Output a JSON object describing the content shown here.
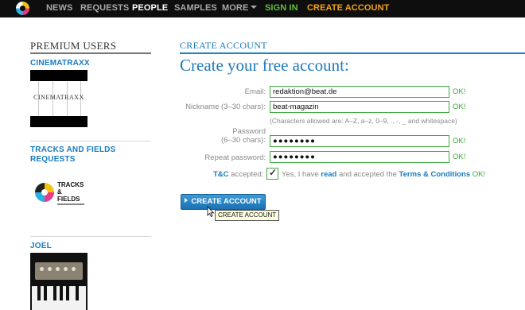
{
  "nav": {
    "items": [
      {
        "label": "NEWS"
      },
      {
        "label": "REQUESTS"
      },
      {
        "label": "PEOPLE"
      },
      {
        "label": "SAMPLES"
      },
      {
        "label": "MORE"
      },
      {
        "label": "SIGN IN"
      },
      {
        "label": "CREATE ACCOUNT"
      }
    ],
    "active": "PEOPLE",
    "logo_icon": "site-logo-icon"
  },
  "sidebar": {
    "title": "PREMIUM USERS",
    "users": [
      {
        "name": "CINEMATRAXX",
        "image_text": "CINEMATRAXX"
      },
      {
        "name": "TRACKS AND FIELDS REQUESTS",
        "name_line1": "TRACKS AND FIELDS",
        "name_line2": "REQUESTS",
        "logo_line1": "TRACKS",
        "logo_line2": "&",
        "logo_line3": "FIELDS"
      },
      {
        "name": "JOEL"
      }
    ]
  },
  "form": {
    "section_title": "CREATE ACCOUNT",
    "heading": "Create your free account:",
    "email_label": "Email:",
    "email_value": "redaktion@beat.de",
    "nickname_label": "Nickname (3–30 chars):",
    "nickname_value": "beat-magazin",
    "nickname_hint": "(Characters allowed are: A–Z, a–z, 0–9, ., -, _ and whitespace)",
    "password_label_line1": "Password",
    "password_label_line2": "(6–30 chars):",
    "password_value": "●●●●●●●●",
    "repeat_label": "Repeat password:",
    "repeat_value": "●●●●●●●●",
    "ok": "OK!",
    "tc_label_prefix": "T&C",
    "tc_label_suffix": " accepted:",
    "tc_text_1": "Yes, I have ",
    "tc_link_read": "read",
    "tc_text_2": " and accepted the ",
    "tc_link_terms": "Terms & Conditions",
    "tc_ok": " OK!",
    "tc_checked": true,
    "submit_label": "CREATE ACCOUNT",
    "tooltip": "CREATE ACCOUNT"
  },
  "colors": {
    "accent": "#1a7bbf",
    "ok_green": "#3ca53c",
    "signin_green": "#5fc43a",
    "create_orange": "#f5a214",
    "nav_bg": "#0e0e0e"
  }
}
